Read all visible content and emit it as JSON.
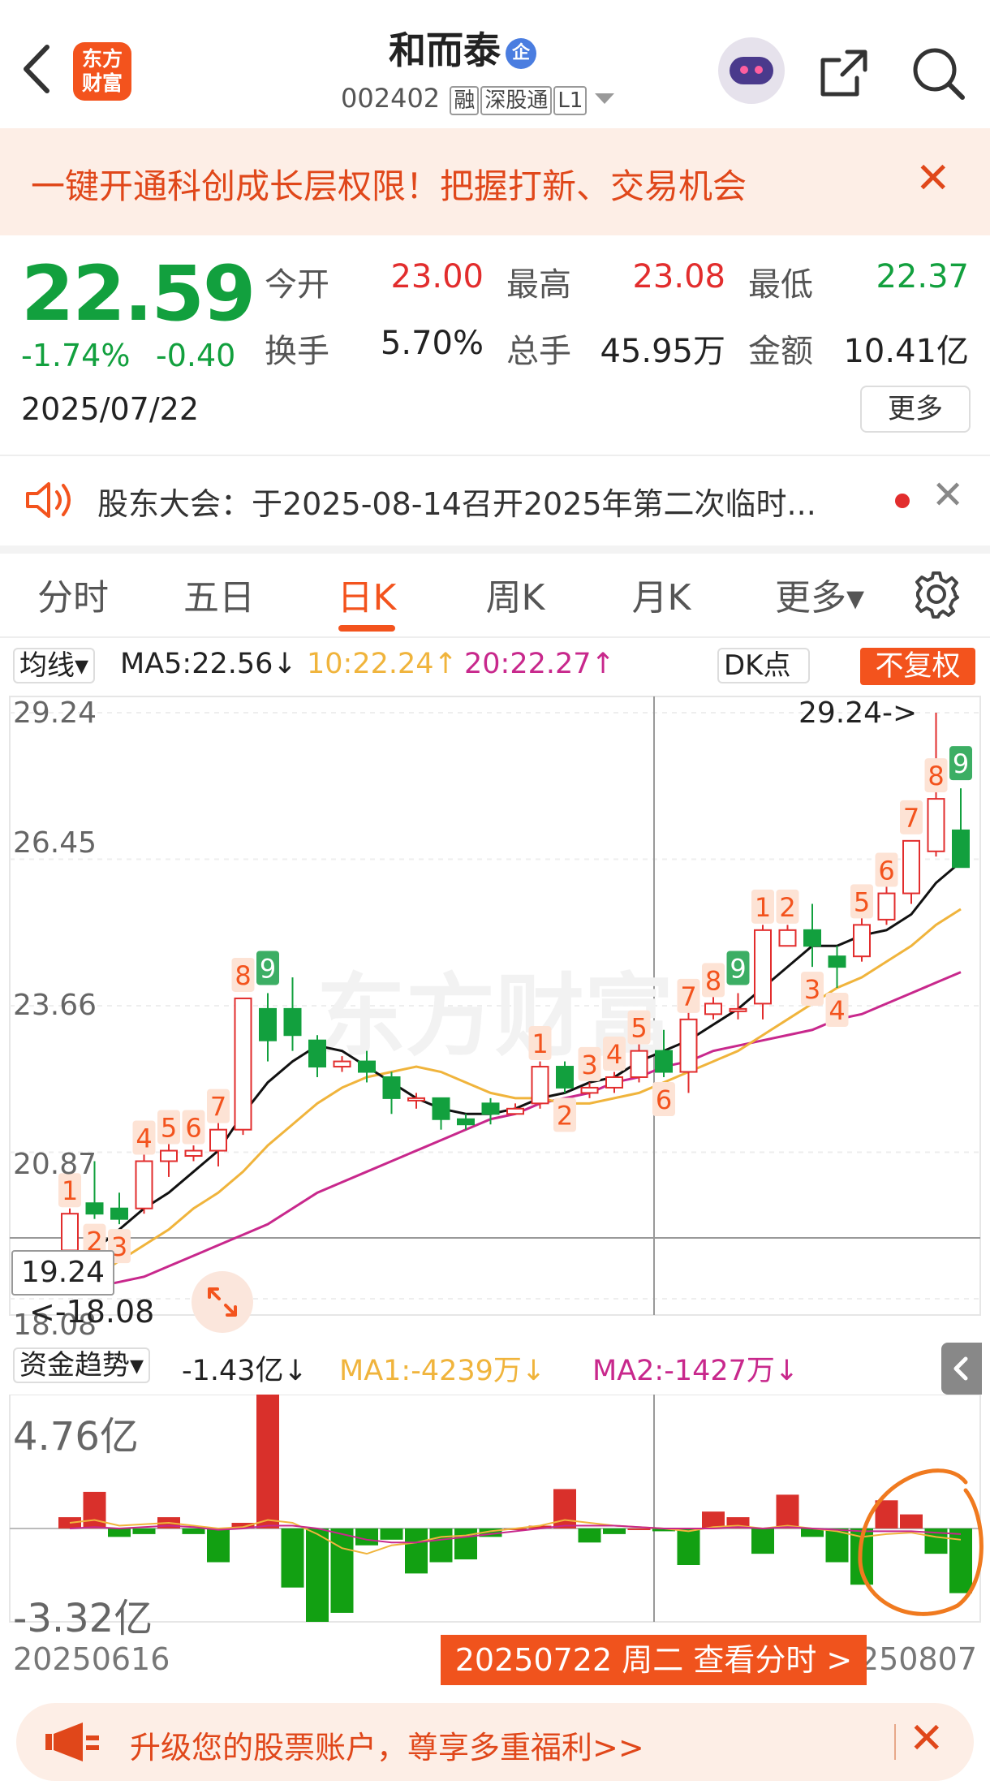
{
  "header": {
    "back_icon": "chevron-left-icon",
    "logo_line1": "东方",
    "logo_line2": "财富",
    "stock_name": "和而泰",
    "badge": "企",
    "code": "002402",
    "tag1": "融",
    "tag2": "深股通",
    "tag3": "L1"
  },
  "banner": {
    "text": "一键开通科创成长层权限！把握打新、交易机会",
    "close": "✕"
  },
  "quote": {
    "price": "22.59",
    "pct_change": "-1.74%",
    "abs_change": "-0.40",
    "date": "2025/07/22",
    "open_label": "今开",
    "open": "23.00",
    "high_label": "最高",
    "high": "23.08",
    "low_label": "最低",
    "low": "22.37",
    "turnover_label": "换手",
    "turnover": "5.70%",
    "volume_label": "总手",
    "volume": "45.95万",
    "amount_label": "金额",
    "amount": "10.41亿",
    "more": "更多"
  },
  "notice": {
    "icon": "speaker-icon",
    "text": "股东大会：于2025-08-14召开2025年第二次临时...",
    "close": "✕"
  },
  "tabs": [
    "分时",
    "五日",
    "日K",
    "周K",
    "月K",
    "更多▾"
  ],
  "active_tab": "日K",
  "ma_bar": {
    "dropdown": "均线▾",
    "ma5": "MA5:22.56↓",
    "ma10": "10:22.24↑",
    "ma20": "20:22.27↑",
    "dk": "DK点",
    "restore": "不复权"
  },
  "chart_labels": {
    "y_top": "29.24",
    "y_2": "26.45",
    "y_3": "23.66",
    "y_4": "20.87",
    "y_bottom": "18.08",
    "max_note": "29.24->",
    "min_note": "<-18.08",
    "crosshair_price": "19.24"
  },
  "fund_bar": {
    "dropdown": "资金趋势▾",
    "value": "-1.43亿↓",
    "ma1": "MA1:-4239万↓",
    "ma2": "MA2:-1427万↓",
    "y_top": "4.76亿",
    "y_bottom": "-3.32亿"
  },
  "x_axis": {
    "start": "20250616",
    "end": "20250807",
    "pill": "20250722 周二 查看分时 >"
  },
  "promo": {
    "icon": "megaphone-icon",
    "text": "升级您的股票账户，尊享多重福利>>",
    "close": "✕"
  },
  "colors": {
    "up": "#e22d2d",
    "down": "#12a03e",
    "accent": "#f3531d",
    "ma5": "#111111",
    "ma10": "#f0b43c",
    "ma20": "#c8288c"
  },
  "chart_data": {
    "type": "candlestick",
    "xlabel": "",
    "ylabel": "",
    "ylim": [
      18.08,
      29.24
    ],
    "x_range": [
      "20250616",
      "20250807"
    ],
    "candles": [
      {
        "o": 19.0,
        "h": 19.8,
        "l": 18.3,
        "c": 19.7,
        "td": "1"
      },
      {
        "o": 19.9,
        "h": 20.7,
        "l": 19.6,
        "c": 19.7,
        "td": "2"
      },
      {
        "o": 19.8,
        "h": 20.1,
        "l": 19.5,
        "c": 19.6,
        "td": "3"
      },
      {
        "o": 19.8,
        "h": 21.0,
        "l": 19.7,
        "c": 20.7,
        "td": "4"
      },
      {
        "o": 20.7,
        "h": 21.2,
        "l": 20.4,
        "c": 20.9,
        "td": "5"
      },
      {
        "o": 20.8,
        "h": 21.0,
        "l": 20.7,
        "c": 20.9,
        "td": "6"
      },
      {
        "o": 20.9,
        "h": 21.5,
        "l": 20.6,
        "c": 21.3,
        "td": "7"
      },
      {
        "o": 21.3,
        "h": 23.8,
        "l": 21.2,
        "c": 23.8,
        "td": "8"
      },
      {
        "o": 23.6,
        "h": 23.9,
        "l": 22.6,
        "c": 23.0,
        "td": "9"
      },
      {
        "o": 23.6,
        "h": 24.2,
        "l": 22.8,
        "c": 23.1,
        "td": ""
      },
      {
        "o": 23.0,
        "h": 23.1,
        "l": 22.3,
        "c": 22.5,
        "td": ""
      },
      {
        "o": 22.5,
        "h": 22.7,
        "l": 22.4,
        "c": 22.6,
        "td": ""
      },
      {
        "o": 22.6,
        "h": 22.8,
        "l": 22.2,
        "c": 22.4,
        "td": ""
      },
      {
        "o": 22.3,
        "h": 22.4,
        "l": 21.6,
        "c": 21.9,
        "td": ""
      },
      {
        "o": 21.9,
        "h": 22.0,
        "l": 21.7,
        "c": 21.9,
        "td": ""
      },
      {
        "o": 21.9,
        "h": 21.9,
        "l": 21.3,
        "c": 21.5,
        "td": ""
      },
      {
        "o": 21.5,
        "h": 21.6,
        "l": 21.3,
        "c": 21.4,
        "td": ""
      },
      {
        "o": 21.8,
        "h": 21.9,
        "l": 21.4,
        "c": 21.6,
        "td": ""
      },
      {
        "o": 21.6,
        "h": 21.8,
        "l": 21.6,
        "c": 21.7,
        "td": ""
      },
      {
        "o": 21.8,
        "h": 22.6,
        "l": 21.7,
        "c": 22.5,
        "td": "1"
      },
      {
        "o": 22.5,
        "h": 22.6,
        "l": 22.0,
        "c": 22.1,
        "td": "2"
      },
      {
        "o": 22.0,
        "h": 22.2,
        "l": 21.9,
        "c": 22.1,
        "td": "3"
      },
      {
        "o": 22.1,
        "h": 22.4,
        "l": 22.0,
        "c": 22.3,
        "td": "4"
      },
      {
        "o": 22.3,
        "h": 23.0,
        "l": 22.2,
        "c": 22.8,
        "td": "5"
      },
      {
        "o": 22.8,
        "h": 23.2,
        "l": 22.3,
        "c": 22.4,
        "td": "6"
      },
      {
        "o": 22.4,
        "h": 23.8,
        "l": 22.0,
        "c": 23.4,
        "td": "7"
      },
      {
        "o": 23.5,
        "h": 24.4,
        "l": 23.4,
        "c": 23.7,
        "td": "8"
      },
      {
        "o": 23.6,
        "h": 23.9,
        "l": 23.4,
        "c": 23.6,
        "td": "9"
      },
      {
        "o": 23.7,
        "h": 25.2,
        "l": 23.4,
        "c": 25.1,
        "td": "1"
      },
      {
        "o": 24.8,
        "h": 25.2,
        "l": 24.8,
        "c": 25.1,
        "td": "2"
      },
      {
        "o": 25.1,
        "h": 25.6,
        "l": 24.4,
        "c": 24.8,
        "td": "3"
      },
      {
        "o": 24.6,
        "h": 24.8,
        "l": 24.0,
        "c": 24.4,
        "td": "4"
      },
      {
        "o": 24.6,
        "h": 25.5,
        "l": 24.5,
        "c": 25.2,
        "td": "5"
      },
      {
        "o": 25.3,
        "h": 26.2,
        "l": 25.2,
        "c": 25.8,
        "td": "6"
      },
      {
        "o": 25.8,
        "h": 26.8,
        "l": 25.6,
        "c": 26.8,
        "td": "7"
      },
      {
        "o": 26.6,
        "h": 29.24,
        "l": 26.5,
        "c": 27.6,
        "td": "8"
      },
      {
        "o": 27.0,
        "h": 27.8,
        "l": 26.3,
        "c": 26.3,
        "td": "9"
      }
    ],
    "ma5": [
      18.4,
      19.0,
      19.4,
      19.8,
      20.1,
      20.5,
      20.9,
      21.6,
      22.2,
      22.6,
      22.9,
      22.8,
      22.5,
      22.2,
      21.9,
      21.7,
      21.6,
      21.6,
      21.7,
      21.9,
      22.0,
      22.2,
      22.3,
      22.6,
      22.8,
      23.0,
      23.3,
      23.6,
      24.0,
      24.4,
      24.8,
      24.8,
      25.0,
      25.1,
      25.4,
      26.0,
      26.4
    ],
    "ma10": [
      18.2,
      18.5,
      18.8,
      19.1,
      19.4,
      19.8,
      20.1,
      20.5,
      21.0,
      21.4,
      21.8,
      22.1,
      22.3,
      22.4,
      22.5,
      22.4,
      22.2,
      22.0,
      21.9,
      21.9,
      21.8,
      21.8,
      21.9,
      22.0,
      22.2,
      22.4,
      22.6,
      22.8,
      23.1,
      23.4,
      23.7,
      24.0,
      24.2,
      24.5,
      24.8,
      25.2,
      25.5
    ],
    "ma20": [
      18.2,
      18.3,
      18.4,
      18.5,
      18.7,
      18.9,
      19.1,
      19.3,
      19.5,
      19.8,
      20.1,
      20.3,
      20.5,
      20.7,
      20.9,
      21.1,
      21.3,
      21.5,
      21.6,
      21.8,
      21.9,
      22.0,
      22.2,
      22.3,
      22.5,
      22.6,
      22.8,
      22.9,
      23.0,
      23.1,
      23.2,
      23.4,
      23.5,
      23.7,
      23.9,
      24.1,
      24.3
    ],
    "fund_flow": {
      "ylim": [
        -3.32,
        4.76
      ],
      "unit": "亿",
      "values": [
        0.4,
        1.3,
        -0.3,
        -0.2,
        0.4,
        -0.2,
        -1.2,
        0.2,
        4.76,
        -2.1,
        -3.32,
        -3.0,
        -0.6,
        -0.4,
        -1.6,
        -1.2,
        -1.1,
        -0.3,
        0.0,
        0.1,
        1.4,
        -0.5,
        -0.2,
        0.0,
        -0.1,
        -1.3,
        0.6,
        0.4,
        -0.9,
        1.2,
        -0.3,
        -1.2,
        -2.0,
        1.0,
        0.5,
        -0.9,
        -2.3
      ],
      "ma1": [
        0.2,
        0.3,
        0.1,
        0.15,
        0.2,
        0.1,
        0.0,
        0.05,
        0.3,
        0.2,
        -0.2,
        -0.7,
        -0.9,
        -0.6,
        -0.5,
        -0.3,
        -0.25,
        -0.1,
        0.0,
        0.1,
        0.3,
        0.2,
        0.1,
        0.05,
        0.0,
        -0.1,
        0.05,
        0.1,
        0.0,
        0.1,
        0.0,
        -0.1,
        -0.3,
        -0.2,
        -0.15,
        -0.3,
        -0.4
      ],
      "ma2": [
        0.0,
        0.05,
        0.0,
        0.05,
        0.1,
        0.05,
        -0.05,
        0.0,
        0.1,
        0.1,
        0.0,
        -0.2,
        -0.4,
        -0.5,
        -0.5,
        -0.4,
        -0.3,
        -0.2,
        -0.1,
        0.0,
        0.1,
        0.1,
        0.1,
        0.05,
        0.0,
        0.0,
        0.0,
        0.05,
        0.0,
        0.05,
        0.0,
        -0.05,
        -0.1,
        -0.1,
        -0.1,
        -0.15,
        -0.2
      ]
    }
  }
}
